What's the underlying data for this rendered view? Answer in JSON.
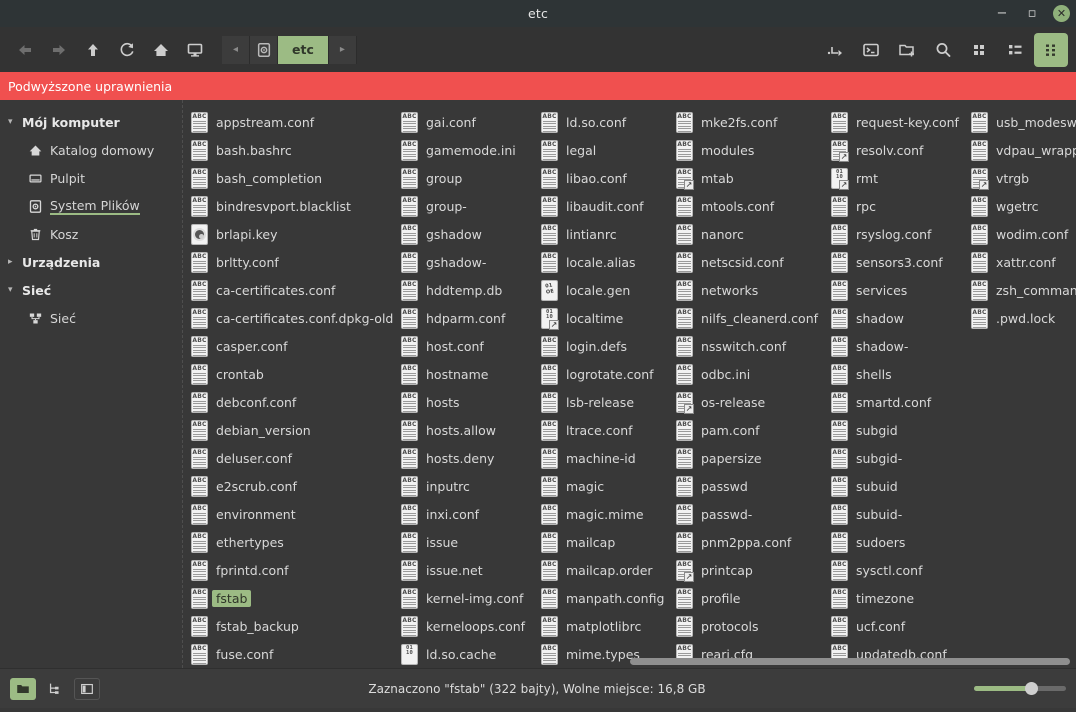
{
  "window": {
    "title": "etc",
    "minimize": "−",
    "maximize": "▫",
    "close": "✕"
  },
  "toolbar": {
    "back": "back-arrow",
    "forward": "forward-arrow",
    "up": "up-arrow",
    "reload": "reload",
    "home": "home",
    "computer": "computer",
    "path_prev": "◂",
    "path_next": "▸",
    "path_root_icon": "filesystem-icon",
    "path_current": "etc",
    "open_terminal_here": "open-terminal-here",
    "terminal": "terminal",
    "new_folder": "new-folder",
    "search": "search",
    "view_icons": "icon-view",
    "view_list": "list-view",
    "view_compact": "compact-view"
  },
  "banner": {
    "text": "Podwyższone uprawnienia"
  },
  "sidebar": {
    "groups": [
      {
        "label": "Mój komputer",
        "expanded": true,
        "tri": "▾",
        "items": [
          {
            "label": "Katalog domowy",
            "icon": "home-icon",
            "current": false
          },
          {
            "label": "Pulpit",
            "icon": "desktop-icon",
            "current": false
          },
          {
            "label": "System Plików",
            "icon": "filesystem-icon",
            "current": true
          },
          {
            "label": "Kosz",
            "icon": "trash-icon",
            "current": false
          }
        ]
      },
      {
        "label": "Urządzenia",
        "expanded": false,
        "tri": "▸",
        "items": []
      },
      {
        "label": "Sieć",
        "expanded": true,
        "tri": "▾",
        "items": [
          {
            "label": "Sieć",
            "icon": "network-icon",
            "current": false
          }
        ]
      }
    ]
  },
  "files": {
    "columns": [
      {
        "width": "w1",
        "items": [
          {
            "name": "appstream.conf",
            "icon": "text"
          },
          {
            "name": "bash.bashrc",
            "icon": "text"
          },
          {
            "name": "bash_completion",
            "icon": "text"
          },
          {
            "name": "bindresvport.blacklist",
            "icon": "text"
          },
          {
            "name": "brlapi.key",
            "icon": "key"
          },
          {
            "name": "brltty.conf",
            "icon": "text"
          },
          {
            "name": "ca-certificates.conf",
            "icon": "text"
          },
          {
            "name": "ca-certificates.conf.dpkg-old",
            "icon": "text"
          },
          {
            "name": "casper.conf",
            "icon": "text"
          },
          {
            "name": "crontab",
            "icon": "text"
          },
          {
            "name": "debconf.conf",
            "icon": "text"
          },
          {
            "name": "debian_version",
            "icon": "text"
          },
          {
            "name": "deluser.conf",
            "icon": "text"
          },
          {
            "name": "e2scrub.conf",
            "icon": "text"
          },
          {
            "name": "environment",
            "icon": "text"
          },
          {
            "name": "ethertypes",
            "icon": "text"
          },
          {
            "name": "fprintd.conf",
            "icon": "text"
          },
          {
            "name": "fstab",
            "icon": "text",
            "selected": true
          },
          {
            "name": "fstab_backup",
            "icon": "text"
          },
          {
            "name": "fuse.conf",
            "icon": "text"
          }
        ]
      },
      {
        "width": "w2",
        "items": [
          {
            "name": "gai.conf",
            "icon": "text"
          },
          {
            "name": "gamemode.ini",
            "icon": "text"
          },
          {
            "name": "group",
            "icon": "text"
          },
          {
            "name": "group-",
            "icon": "text"
          },
          {
            "name": "gshadow",
            "icon": "text"
          },
          {
            "name": "gshadow-",
            "icon": "text"
          },
          {
            "name": "hddtemp.db",
            "icon": "text"
          },
          {
            "name": "hdparm.conf",
            "icon": "text"
          },
          {
            "name": "host.conf",
            "icon": "text"
          },
          {
            "name": "hostname",
            "icon": "text"
          },
          {
            "name": "hosts",
            "icon": "text"
          },
          {
            "name": "hosts.allow",
            "icon": "text"
          },
          {
            "name": "hosts.deny",
            "icon": "text"
          },
          {
            "name": "inputrc",
            "icon": "text"
          },
          {
            "name": "inxi.conf",
            "icon": "text"
          },
          {
            "name": "issue",
            "icon": "text"
          },
          {
            "name": "issue.net",
            "icon": "text"
          },
          {
            "name": "kernel-img.conf",
            "icon": "text"
          },
          {
            "name": "kerneloops.conf",
            "icon": "text"
          },
          {
            "name": "ld.so.cache",
            "icon": "binary"
          }
        ]
      },
      {
        "width": "w3",
        "items": [
          {
            "name": "ld.so.conf",
            "icon": "text"
          },
          {
            "name": "legal",
            "icon": "text"
          },
          {
            "name": "libao.conf",
            "icon": "text"
          },
          {
            "name": "libaudit.conf",
            "icon": "text"
          },
          {
            "name": "lintianrc",
            "icon": "text"
          },
          {
            "name": "locale.alias",
            "icon": "text"
          },
          {
            "name": "locale.gen",
            "icon": "gen"
          },
          {
            "name": "localtime",
            "icon": "binary",
            "link": true
          },
          {
            "name": "login.defs",
            "icon": "text"
          },
          {
            "name": "logrotate.conf",
            "icon": "text"
          },
          {
            "name": "lsb-release",
            "icon": "text"
          },
          {
            "name": "ltrace.conf",
            "icon": "text"
          },
          {
            "name": "machine-id",
            "icon": "text"
          },
          {
            "name": "magic",
            "icon": "text"
          },
          {
            "name": "magic.mime",
            "icon": "text"
          },
          {
            "name": "mailcap",
            "icon": "text"
          },
          {
            "name": "mailcap.order",
            "icon": "text"
          },
          {
            "name": "manpath.config",
            "icon": "text"
          },
          {
            "name": "matplotlibrc",
            "icon": "text"
          },
          {
            "name": "mime.types",
            "icon": "text"
          }
        ]
      },
      {
        "width": "w4",
        "items": [
          {
            "name": "mke2fs.conf",
            "icon": "text"
          },
          {
            "name": "modules",
            "icon": "text"
          },
          {
            "name": "mtab",
            "icon": "text",
            "link": true
          },
          {
            "name": "mtools.conf",
            "icon": "text"
          },
          {
            "name": "nanorc",
            "icon": "text"
          },
          {
            "name": "netscsid.conf",
            "icon": "text"
          },
          {
            "name": "networks",
            "icon": "text"
          },
          {
            "name": "nilfs_cleanerd.conf",
            "icon": "text"
          },
          {
            "name": "nsswitch.conf",
            "icon": "text"
          },
          {
            "name": "odbc.ini",
            "icon": "text"
          },
          {
            "name": "os-release",
            "icon": "text",
            "link": true
          },
          {
            "name": "pam.conf",
            "icon": "text"
          },
          {
            "name": "papersize",
            "icon": "text"
          },
          {
            "name": "passwd",
            "icon": "text"
          },
          {
            "name": "passwd-",
            "icon": "text"
          },
          {
            "name": "pnm2ppa.conf",
            "icon": "text"
          },
          {
            "name": "printcap",
            "icon": "text",
            "link": true
          },
          {
            "name": "profile",
            "icon": "text"
          },
          {
            "name": "protocols",
            "icon": "text"
          },
          {
            "name": "rearj.cfg",
            "icon": "text"
          }
        ]
      },
      {
        "width": "w5",
        "items": [
          {
            "name": "request-key.conf",
            "icon": "text"
          },
          {
            "name": "resolv.conf",
            "icon": "text",
            "link": true
          },
          {
            "name": "rmt",
            "icon": "binary",
            "link": true
          },
          {
            "name": "rpc",
            "icon": "text"
          },
          {
            "name": "rsyslog.conf",
            "icon": "text"
          },
          {
            "name": "sensors3.conf",
            "icon": "text"
          },
          {
            "name": "services",
            "icon": "text"
          },
          {
            "name": "shadow",
            "icon": "text"
          },
          {
            "name": "shadow-",
            "icon": "text"
          },
          {
            "name": "shells",
            "icon": "text"
          },
          {
            "name": "smartd.conf",
            "icon": "text"
          },
          {
            "name": "subgid",
            "icon": "text"
          },
          {
            "name": "subgid-",
            "icon": "text"
          },
          {
            "name": "subuid",
            "icon": "text"
          },
          {
            "name": "subuid-",
            "icon": "text"
          },
          {
            "name": "sudoers",
            "icon": "text"
          },
          {
            "name": "sysctl.conf",
            "icon": "text"
          },
          {
            "name": "timezone",
            "icon": "text"
          },
          {
            "name": "ucf.conf",
            "icon": "text"
          },
          {
            "name": "updatedb.conf",
            "icon": "text"
          }
        ]
      },
      {
        "width": "w6",
        "items": [
          {
            "name": "usb_modeswitch.conf",
            "icon": "text"
          },
          {
            "name": "vdpau_wrapper.cfg",
            "icon": "text"
          },
          {
            "name": "vtrgb",
            "icon": "text",
            "link": true
          },
          {
            "name": "wgetrc",
            "icon": "text"
          },
          {
            "name": "wodim.conf",
            "icon": "text"
          },
          {
            "name": "xattr.conf",
            "icon": "text"
          },
          {
            "name": "zsh_command_not_found",
            "icon": "text"
          },
          {
            "name": ".pwd.lock",
            "icon": "text"
          }
        ]
      }
    ]
  },
  "statusbar": {
    "text": "Zaznaczono \"fstab\" (322 bajty), Wolne miejsce: 16,8 GB",
    "btn_folder": "folder-view-button",
    "btn_tree": "tree-view-button",
    "btn_sidepane": "side-pane-button",
    "zoom_percent": 62
  },
  "colors": {
    "accent": "#9cbb84",
    "warning": "#f0504f",
    "bg": "#383838",
    "titlebar": "#2e3436"
  }
}
